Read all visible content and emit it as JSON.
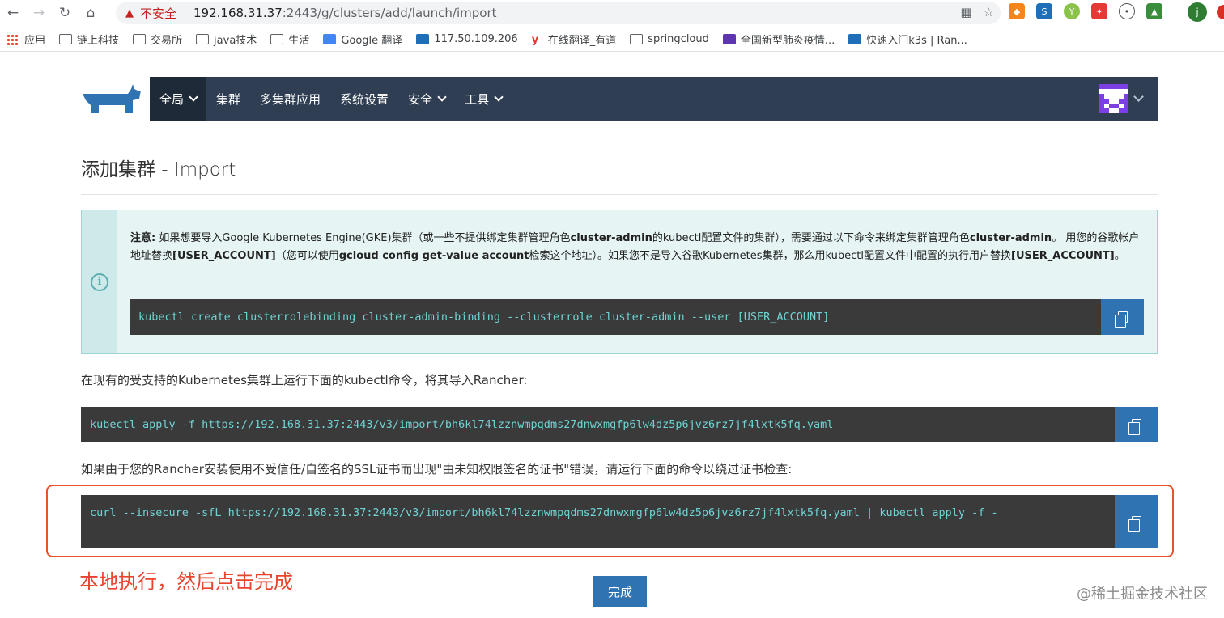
{
  "browser": {
    "insecure_label": "不安全",
    "url_host": "192.168.31.37",
    "url_rest": ":2443/g/clusters/add/launch/import",
    "profile_initial": "j"
  },
  "bookmarks": [
    {
      "label": "应用",
      "icon": "apps-icon"
    },
    {
      "label": "链上科技",
      "icon": "folder-icon"
    },
    {
      "label": "交易所",
      "icon": "folder-icon"
    },
    {
      "label": "java技术",
      "icon": "folder-icon"
    },
    {
      "label": "生活",
      "icon": "folder-icon"
    },
    {
      "label": "Google 翻译",
      "icon": "google-translate-icon"
    },
    {
      "label": "117.50.109.206",
      "icon": "rancher-icon"
    },
    {
      "label": "在线翻译_有道",
      "icon": "youdao-icon"
    },
    {
      "label": "springcloud",
      "icon": "folder-icon"
    },
    {
      "label": "全国新型肺炎疫情...",
      "icon": "site-icon"
    },
    {
      "label": "快速入门k3s | Ran...",
      "icon": "rancher-icon"
    }
  ],
  "nav": {
    "global": "全局",
    "clusters": "集群",
    "multi_cluster_apps": "多集群应用",
    "settings": "系统设置",
    "security": "安全",
    "tools": "工具"
  },
  "page": {
    "title": "添加集群 - Import"
  },
  "note": {
    "label": "注意:",
    "t1": " 如果想要导入Google Kubernetes Engine(GKE)集群（或一些不提供绑定集群管理角色",
    "b1": "cluster-admin",
    "t2": "的kubectl配置文件的集群），需要通过以下命令来绑定集群管理角色",
    "b2": "cluster-admin",
    "t3": "。 用您的谷歌帐户地址替换",
    "b3": "[USER_ACCOUNT]",
    "t4": "（您可以使用",
    "b4": "gcloud config get-value account",
    "t5": "检索这个地址）。如果您不是导入谷歌Kubernetes集群，那么用kubectl配置文件中配置的执行用户替换",
    "b5": "[USER_ACCOUNT]",
    "t6": "。",
    "command": "kubectl create clusterrolebinding cluster-admin-binding --clusterrole cluster-admin --user [USER_ACCOUNT]"
  },
  "import": {
    "instruction": "在现有的受支持的Kubernetes集群上运行下面的kubectl命令，将其导入Rancher:",
    "command": "kubectl apply -f https://192.168.31.37:2443/v3/import/bh6kl74lzznwmpqdms27dnwxmgfp6lw4dz5p6jvz6rz7jf4lxtk5fq.yaml",
    "insecure_instruction": "如果由于您的Rancher安装使用不受信任/自签名的SSL证书而出现\"由未知权限签名的证书\"错误，请运行下面的命令以绕过证书检查:",
    "insecure_command": "curl --insecure -sfL https://192.168.31.37:2443/v3/import/bh6kl74lzznwmpqdms27dnwxmgfp6lw4dz5p6jvz6rz7jf4lxtk5fq.yaml | kubectl apply -f -"
  },
  "annotation": "本地执行，然后点击完成",
  "done_label": "完成",
  "watermark": "@稀土掘金技术社区",
  "colors": {
    "nav_bg": "#2f3e52",
    "primary": "#2f73b3",
    "code_bg": "#3a3a3a",
    "code_text": "#6fd3d3",
    "annotation": "#e8432b"
  }
}
